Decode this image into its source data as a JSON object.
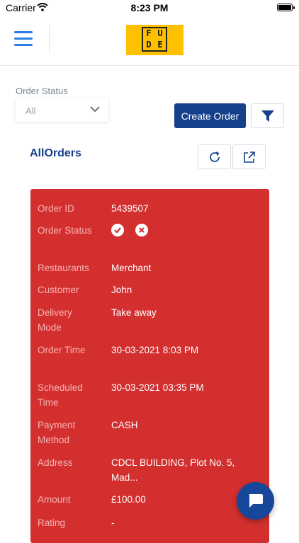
{
  "status_bar": {
    "carrier": "Carrier",
    "time": "8:23 PM"
  },
  "header": {
    "logo_letters": [
      "F",
      "U",
      "D",
      "E"
    ]
  },
  "filters": {
    "order_status_label": "Order Status",
    "order_status_value": "All",
    "create_order_label": "Create Order"
  },
  "section": {
    "title": "AllOrders"
  },
  "order": {
    "rows": [
      {
        "label": "Order ID",
        "value": "5439507"
      },
      {
        "label": "Order Status",
        "value": ""
      },
      {
        "label": "Restaurants",
        "value": "Merchant"
      },
      {
        "label": "Customer",
        "value": "John"
      },
      {
        "label": "Delivery Mode",
        "value": "Take away"
      },
      {
        "label": "Order Time",
        "value": "30-03-2021 8:03 PM"
      },
      {
        "label": "Scheduled Time",
        "value": "30-03-2021 03:35 PM"
      },
      {
        "label": "Payment Method",
        "value": "CASH"
      },
      {
        "label": "Address",
        "value": "CDCL BUILDING, Plot No. 5, Mad..."
      },
      {
        "label": "Amount",
        "value": "£100.00"
      },
      {
        "label": "Rating",
        "value": "-"
      }
    ]
  },
  "colors": {
    "brand_blue": "#16408a",
    "menu_blue": "#2a7de1",
    "card_red": "#d32f2f",
    "logo_yellow": "#ffc000"
  }
}
